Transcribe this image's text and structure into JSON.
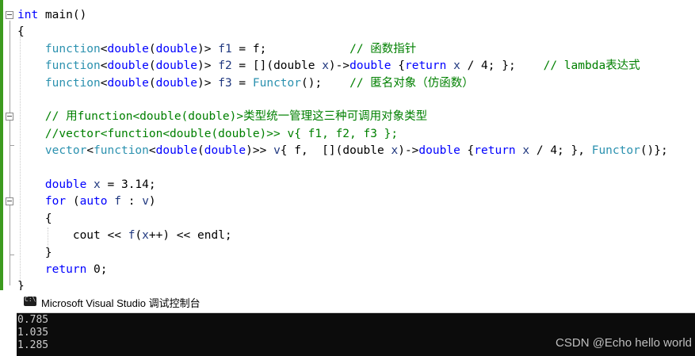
{
  "code": {
    "lines": [
      [
        {
          "c": "kw",
          "t": "int"
        },
        {
          "c": "plain",
          "t": " main()"
        }
      ],
      [
        {
          "c": "plain",
          "t": "{"
        }
      ],
      [
        {
          "c": "plain",
          "t": "    "
        },
        {
          "c": "ty",
          "t": "function"
        },
        {
          "c": "plain",
          "t": "<"
        },
        {
          "c": "kw",
          "t": "double"
        },
        {
          "c": "plain",
          "t": "("
        },
        {
          "c": "kw",
          "t": "double"
        },
        {
          "c": "plain",
          "t": ")> "
        },
        {
          "c": "vr",
          "t": "f1"
        },
        {
          "c": "plain",
          "t": " = f;            "
        },
        {
          "c": "cm",
          "t": "// 函数指针"
        }
      ],
      [
        {
          "c": "plain",
          "t": "    "
        },
        {
          "c": "ty",
          "t": "function"
        },
        {
          "c": "plain",
          "t": "<"
        },
        {
          "c": "kw",
          "t": "double"
        },
        {
          "c": "plain",
          "t": "("
        },
        {
          "c": "kw",
          "t": "double"
        },
        {
          "c": "plain",
          "t": ")> "
        },
        {
          "c": "vr",
          "t": "f2"
        },
        {
          "c": "plain",
          "t": " = [](double "
        },
        {
          "c": "vr",
          "t": "x"
        },
        {
          "c": "plain",
          "t": ")->"
        },
        {
          "c": "kw",
          "t": "double"
        },
        {
          "c": "plain",
          "t": " {"
        },
        {
          "c": "kw",
          "t": "return"
        },
        {
          "c": "plain",
          "t": " "
        },
        {
          "c": "vr",
          "t": "x"
        },
        {
          "c": "plain",
          "t": " / 4; };    "
        },
        {
          "c": "cm",
          "t": "// lambda表达式"
        }
      ],
      [
        {
          "c": "plain",
          "t": "    "
        },
        {
          "c": "ty",
          "t": "function"
        },
        {
          "c": "plain",
          "t": "<"
        },
        {
          "c": "kw",
          "t": "double"
        },
        {
          "c": "plain",
          "t": "("
        },
        {
          "c": "kw",
          "t": "double"
        },
        {
          "c": "plain",
          "t": ")> "
        },
        {
          "c": "vr",
          "t": "f3"
        },
        {
          "c": "plain",
          "t": " = "
        },
        {
          "c": "ty",
          "t": "Functor"
        },
        {
          "c": "plain",
          "t": "();    "
        },
        {
          "c": "cm",
          "t": "// 匿名对象（仿函数）"
        }
      ],
      [],
      [
        {
          "c": "plain",
          "t": "    "
        },
        {
          "c": "cm",
          "t": "// 用function<double(double)>类型统一管理这三种可调用对象类型"
        }
      ],
      [
        {
          "c": "plain",
          "t": "    "
        },
        {
          "c": "cm",
          "t": "//vector<function<double(double)>> v{ f1, f2, f3 };"
        }
      ],
      [
        {
          "c": "plain",
          "t": "    "
        },
        {
          "c": "ty",
          "t": "vector"
        },
        {
          "c": "plain",
          "t": "<"
        },
        {
          "c": "ty",
          "t": "function"
        },
        {
          "c": "plain",
          "t": "<"
        },
        {
          "c": "kw",
          "t": "double"
        },
        {
          "c": "plain",
          "t": "("
        },
        {
          "c": "kw",
          "t": "double"
        },
        {
          "c": "plain",
          "t": ")>> "
        },
        {
          "c": "vr",
          "t": "v"
        },
        {
          "c": "plain",
          "t": "{ f,  [](double "
        },
        {
          "c": "vr",
          "t": "x"
        },
        {
          "c": "plain",
          "t": ")->"
        },
        {
          "c": "kw",
          "t": "double"
        },
        {
          "c": "plain",
          "t": " {"
        },
        {
          "c": "kw",
          "t": "return"
        },
        {
          "c": "plain",
          "t": " "
        },
        {
          "c": "vr",
          "t": "x"
        },
        {
          "c": "plain",
          "t": " / 4; }, "
        },
        {
          "c": "ty",
          "t": "Functor"
        },
        {
          "c": "plain",
          "t": "()};"
        }
      ],
      [],
      [
        {
          "c": "plain",
          "t": "    "
        },
        {
          "c": "kw",
          "t": "double"
        },
        {
          "c": "plain",
          "t": " "
        },
        {
          "c": "vr",
          "t": "x"
        },
        {
          "c": "plain",
          "t": " = 3.14;"
        }
      ],
      [
        {
          "c": "plain",
          "t": "    "
        },
        {
          "c": "kw",
          "t": "for"
        },
        {
          "c": "plain",
          "t": " ("
        },
        {
          "c": "kw",
          "t": "auto"
        },
        {
          "c": "plain",
          "t": " "
        },
        {
          "c": "vr",
          "t": "f"
        },
        {
          "c": "plain",
          "t": " : "
        },
        {
          "c": "vr",
          "t": "v"
        },
        {
          "c": "plain",
          "t": ")"
        }
      ],
      [
        {
          "c": "plain",
          "t": "    {"
        }
      ],
      [
        {
          "c": "plain",
          "t": "        cout << "
        },
        {
          "c": "vr",
          "t": "f"
        },
        {
          "c": "plain",
          "t": "("
        },
        {
          "c": "vr",
          "t": "x"
        },
        {
          "c": "plain",
          "t": "++) << endl;"
        }
      ],
      [
        {
          "c": "plain",
          "t": "    }"
        }
      ],
      [
        {
          "c": "plain",
          "t": "    "
        },
        {
          "c": "kw",
          "t": "return"
        },
        {
          "c": "plain",
          "t": " 0;"
        }
      ],
      [
        {
          "c": "plain",
          "t": "}"
        }
      ]
    ]
  },
  "console": {
    "title": "Microsoft Visual Studio 调试控制台",
    "output": [
      "0.785",
      "1.035",
      "1.285"
    ]
  },
  "watermark": "CSDN @Echo hello world",
  "colors": {
    "keyword": "#0000ff",
    "type": "#2b91af",
    "comment": "#008000",
    "variable": "#1f377f",
    "change_bar": "#3c9a1e",
    "console_bg": "#0c0c0c"
  }
}
